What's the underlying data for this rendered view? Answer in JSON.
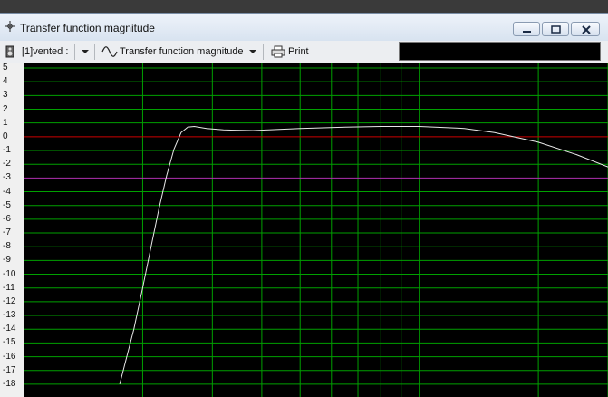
{
  "window": {
    "title": "Transfer function magnitude"
  },
  "toolbar": {
    "box_selector": "[1]vented :",
    "view_selector": "Transfer function magnitude",
    "print_label": "Print",
    "readout_1": "",
    "readout_2": ""
  },
  "colors": {
    "plot_background": "#000000",
    "grid": "#00a000",
    "reference_0db": "#cc0000",
    "reference_minus3db": "#b030b0",
    "curve": "#e8e8e8"
  },
  "chart_data": {
    "type": "line",
    "title": "",
    "xlabel": "",
    "ylabel": "",
    "x_scale": "log",
    "xlim": [
      10,
      300
    ],
    "ylim": [
      -18,
      5
    ],
    "y_ticks": [
      5,
      4,
      3,
      2,
      1,
      0,
      -1,
      -2,
      -3,
      -4,
      -5,
      -6,
      -7,
      -8,
      -9,
      -10,
      -11,
      -12,
      -13,
      -14,
      -15,
      -16,
      -17,
      -18
    ],
    "grid": true,
    "reference_lines": [
      0,
      -3
    ],
    "series": [
      {
        "x": [
          17.5,
          19.0,
          20.0,
          21.0,
          22.0,
          23.0,
          24.0,
          25.0,
          26.0,
          27.0,
          29.0,
          32.0,
          38.0,
          50.0,
          65.0,
          80.0,
          100.0,
          130.0,
          155.0,
          200.0,
          250.0,
          300.0
        ],
        "y": [
          -18.0,
          -14.0,
          -11.0,
          -8.0,
          -5.2,
          -2.8,
          -0.9,
          0.3,
          0.7,
          0.75,
          0.6,
          0.5,
          0.45,
          0.6,
          0.7,
          0.75,
          0.75,
          0.6,
          0.3,
          -0.4,
          -1.3,
          -2.2
        ]
      }
    ]
  }
}
